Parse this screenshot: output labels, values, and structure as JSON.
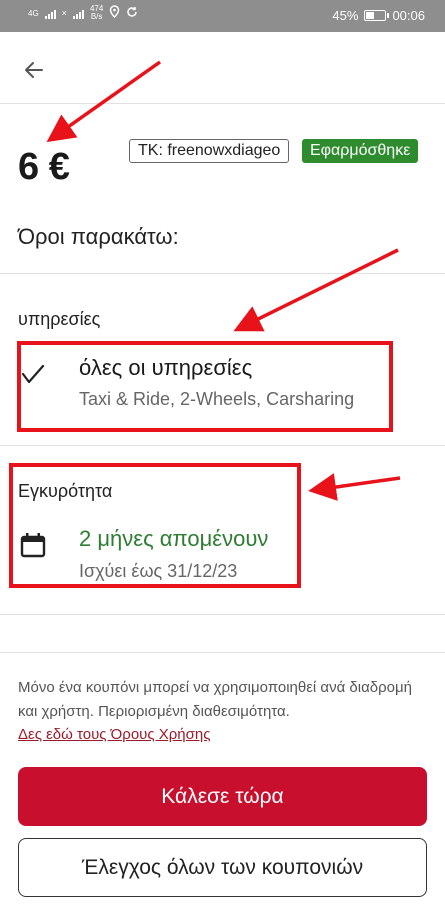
{
  "status_bar": {
    "network": "4G",
    "speed_value": "474",
    "speed_unit": "B/s",
    "battery_text": "45%",
    "battery_level": 0.45,
    "time": "00:06"
  },
  "header": {
    "back_icon": "arrow-left-icon"
  },
  "voucher": {
    "amount": "6 €",
    "code_label": "TK: freenowxdiageo",
    "status_label": "Εφαρμόσθηκε",
    "status_color": "#2e8b2e",
    "terms_heading": "Όροι παρακάτω:"
  },
  "services": {
    "section_label": "υπηρεσίες",
    "icon": "check-icon",
    "title": "όλες οι υπηρεσίες",
    "subtitle": "Taxi & Ride, 2-Wheels, Carsharing"
  },
  "validity": {
    "section_label": "Εγκυρότητα",
    "icon": "calendar-icon",
    "title": "2 μήνες απομένουν",
    "title_color": "#2e7d32",
    "subtitle": "Ισχύει έως 31/12/23"
  },
  "footer": {
    "fineprint": "Μόνο ένα κουπόνι μπορεί να χρησιμοποιηθεί ανά διαδρομή και χρήστη. Περιορισμένη διαθεσιμότητα.",
    "terms_link": "Δες εδώ τους Όρους Χρήσης",
    "primary_button": "Κάλεσε τώρα",
    "secondary_button": "Έλεγχος όλων των κουπονιών",
    "primary_color": "#c8102e"
  },
  "annotations": {
    "color": "#e8121b"
  }
}
